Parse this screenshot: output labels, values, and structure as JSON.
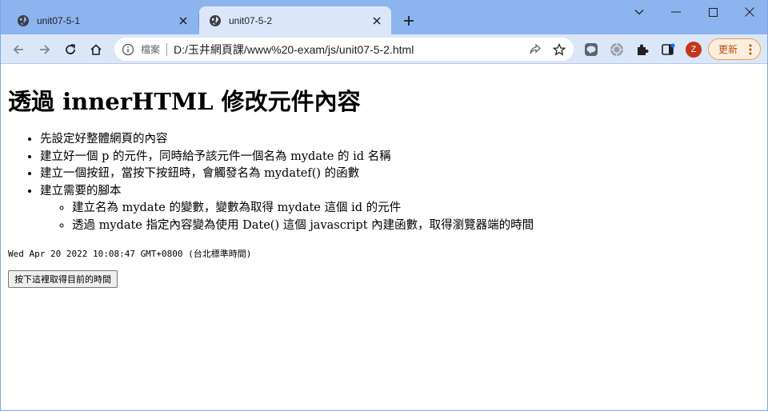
{
  "browser": {
    "tabs": [
      {
        "title": "unit07-5-1",
        "active": false
      },
      {
        "title": "unit07-5-2",
        "active": true
      }
    ],
    "address_bar": {
      "security_label": "檔案",
      "url": "D:/玉井網頁課/www%20-exam/js/unit07-5-2.html"
    },
    "profile_initial": "Z",
    "update_label": "更新"
  },
  "page": {
    "heading": "透過 innerHTML 修改元件內容",
    "steps": [
      "先設定好整體網頁的內容",
      "建立好一個 p 的元件，同時給予該元件一個名為 mydate 的 id 名稱",
      "建立一個按鈕，當按下按鈕時，會觸發名為 mydatef() 的函數",
      "建立需要的腳本"
    ],
    "sub_steps": [
      "建立名為 mydate 的變數，變數為取得 mydate 這個 id 的元件",
      "透過 mydate 指定內容變為使用 Date() 這個 javascript 內建函數，取得瀏覽器端的時間"
    ],
    "date_output": "Wed Apr 20 2022 10:08:47 GMT+0800 (台北標準時間)",
    "button_label": "按下這裡取得目前的時間"
  },
  "colors": {
    "tab_strip": "#8cb4ee",
    "toolbar": "#dbe7f9",
    "profile_avatar": "#c5361b",
    "update_accent": "#e8a04c"
  }
}
